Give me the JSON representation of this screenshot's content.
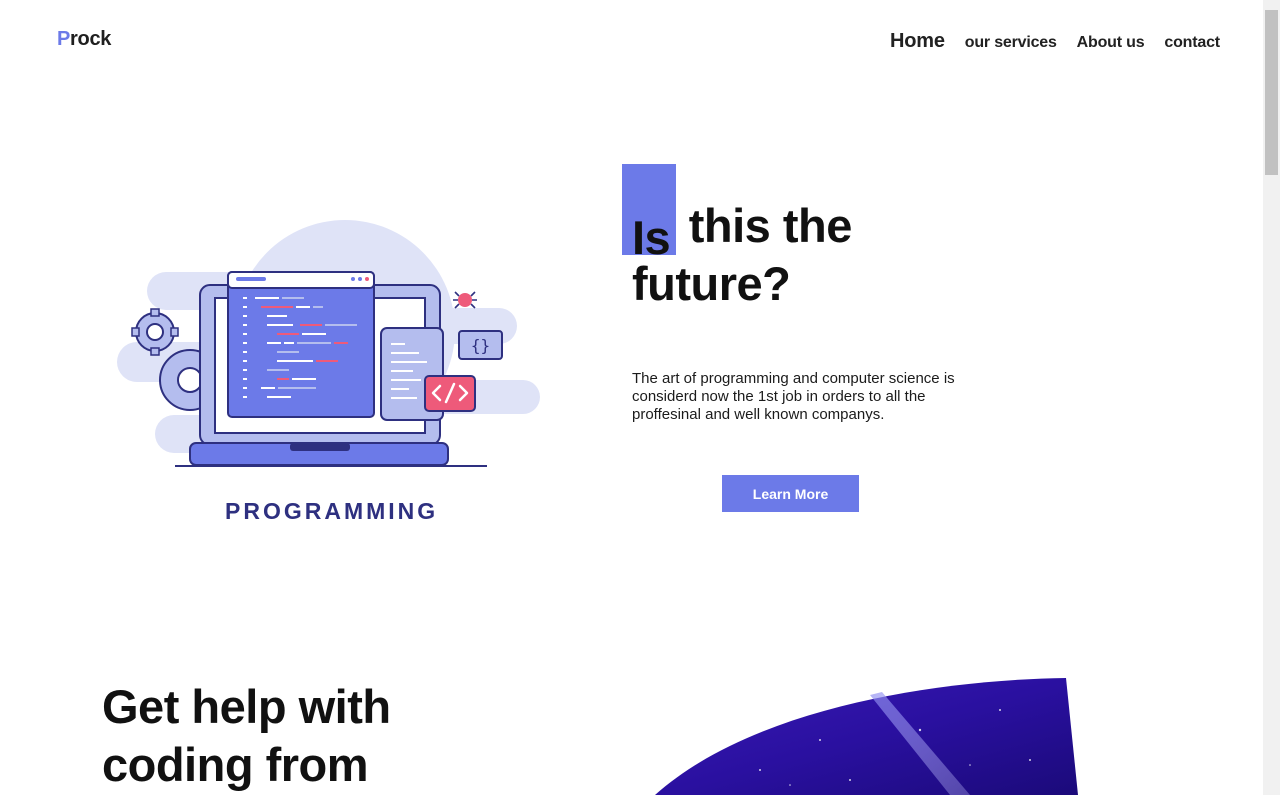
{
  "header": {
    "logo_first": "P",
    "logo_rest": "rock",
    "nav": [
      "Home",
      "our services",
      "About us",
      "contact"
    ]
  },
  "hero": {
    "title_highlight": "Is",
    "title_rest": "this the",
    "title_line2": "future?",
    "description": "The art of programming and computer science is considerd now the 1st job in orders to all the proffesinal and well known companys.",
    "button_label": "Learn More",
    "illustration_caption": "PROGRAMMING"
  },
  "section2": {
    "title": "Get help with coding from"
  },
  "colors": {
    "accent": "#6c7ae8",
    "navy": "#2e3080",
    "code_pink": "#ee5a7a",
    "illustration_light": "#dfe3f7"
  },
  "icons": [
    "gear-icon",
    "bug-icon",
    "curly-braces-icon",
    "code-tag-icon",
    "laptop-icon"
  ]
}
